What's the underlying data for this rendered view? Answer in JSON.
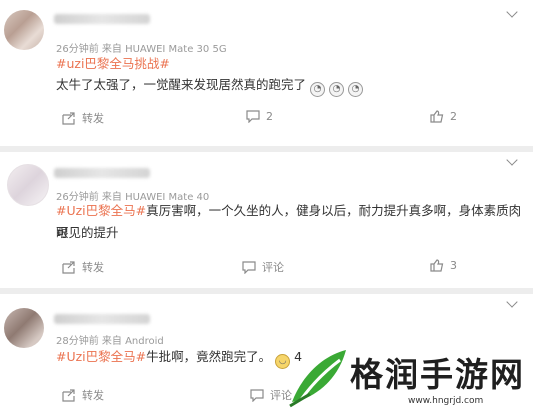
{
  "comments": [
    {
      "time_source": "26分钟前  来自 HUAWEI Mate 30 5G",
      "hashtag": "#uzi巴黎全马挑战#",
      "body": "太牛了太强了，一觉醒来发现居然真的跑完了",
      "emojis": [
        "哭",
        "哭",
        "哭"
      ],
      "repost_label": "转发",
      "comment_label": "2",
      "like_count": "2"
    },
    {
      "time_source": "26分钟前  来自 HUAWEI Mate 40",
      "hashtag": "#Uzi巴黎全马#",
      "body_line1": "真厉害啊，一个久坐的人，健身以后，耐力提升真多啊，身体素质肉眼",
      "body_line2": "可见的提升",
      "repost_label": "转发",
      "comment_label": "评论",
      "like_count": "3"
    },
    {
      "time_source": "28分钟前  来自 Android",
      "hashtag": "#Uzi巴黎全马#",
      "body": "牛批啊，竟然跑完了。",
      "emoji_count": "4",
      "repost_label": "转发",
      "comment_label": "评论"
    }
  ],
  "watermark": {
    "title": "格润手游网",
    "url": "www.hngrjd.com"
  },
  "colors": {
    "accent": "#eb7350",
    "meta": "#9a9a9a",
    "like": "#8a8a8a",
    "logo_green": "#3aa935"
  }
}
